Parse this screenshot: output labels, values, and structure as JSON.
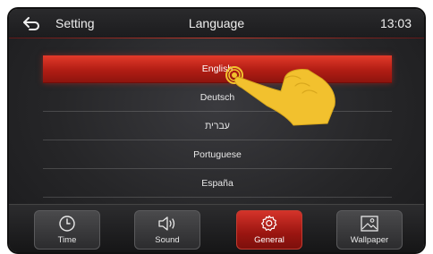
{
  "header": {
    "back_icon": "back-arrow-icon",
    "section": "Setting",
    "title": "Language",
    "time": "13:03"
  },
  "language_list": {
    "items": [
      {
        "label": "English",
        "selected": true
      },
      {
        "label": "Deutsch",
        "selected": false
      },
      {
        "label": "עברית",
        "selected": false
      },
      {
        "label": "Portuguese",
        "selected": false
      },
      {
        "label": "España",
        "selected": false
      }
    ]
  },
  "dock": {
    "tabs": [
      {
        "label": "Time",
        "icon": "clock-icon",
        "active": false
      },
      {
        "label": "Sound",
        "icon": "speaker-icon",
        "active": false
      },
      {
        "label": "General",
        "icon": "gear-icon",
        "active": true
      },
      {
        "label": "Wallpaper",
        "icon": "image-icon",
        "active": false
      }
    ]
  },
  "colors": {
    "accent": "#c0261c",
    "background": "#262628",
    "text": "#e8e8e8",
    "pointer_hand": "#f2c12e"
  }
}
